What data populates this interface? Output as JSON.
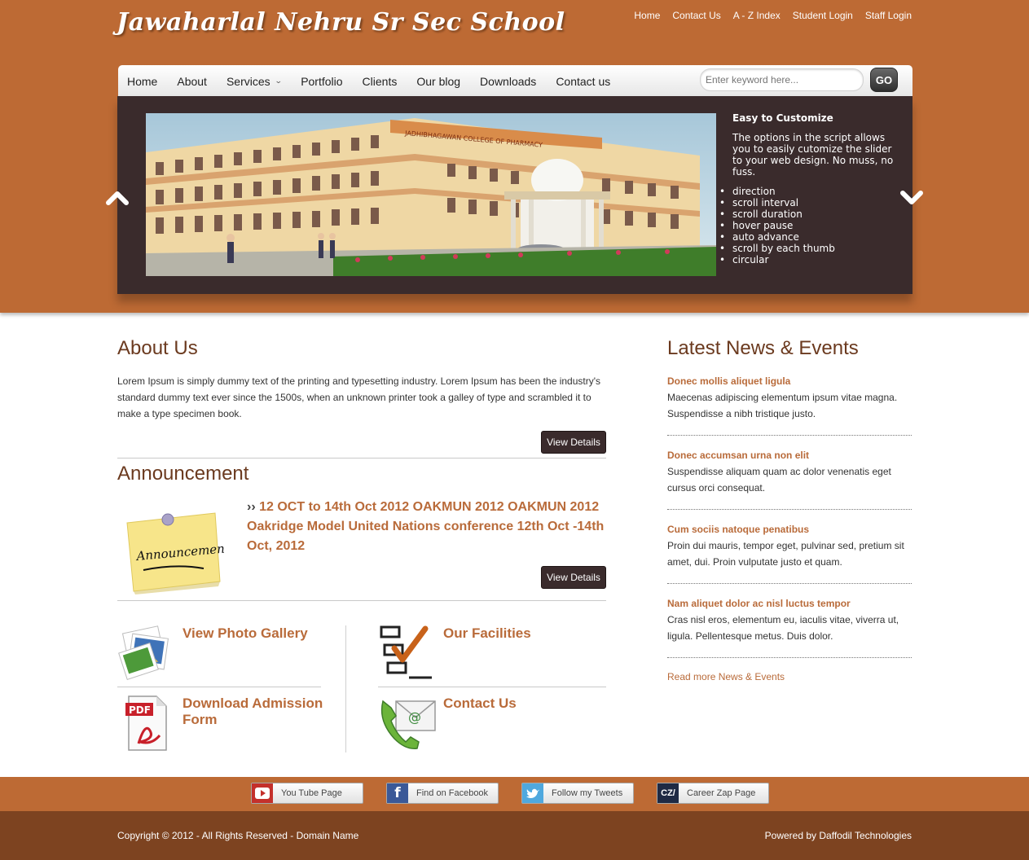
{
  "header": {
    "site_title": "Jawaharlal Nehru Sr Sec School",
    "top_links": [
      "Home",
      "Contact Us",
      "A - Z Index",
      "Student Login",
      "Staff Login"
    ]
  },
  "nav": {
    "items": [
      "Home",
      "About",
      "Services",
      "Portfolio",
      "Clients",
      "Our blog",
      "Downloads",
      "Contact us"
    ],
    "search_placeholder": "Enter keyword here...",
    "search_button": "GO"
  },
  "slider": {
    "image_banner_text": "JADHIBHAGAWAN COLLEGE OF PHARMACY",
    "caption_title": "Easy to Customize",
    "caption_text": "The options in the script allows you to easily cutomize the slider to your web design. No muss, no fuss.",
    "features": [
      "direction",
      "scroll interval",
      "scroll duration",
      "hover pause",
      "auto advance",
      "scroll by each thumb",
      "circular"
    ]
  },
  "about": {
    "title": "About Us",
    "text": "Lorem Ipsum is simply dummy text of the printing and typesetting industry. Lorem Ipsum has been the industry's standard dummy text ever since the 1500s, when an unknown printer took a galley of type and scrambled it to make a type specimen book.",
    "button": "View Details"
  },
  "announcement": {
    "title": "Announcement",
    "note_text": "Announcement!",
    "raquo": "››",
    "text": "12 OCT to 14th Oct 2012 OAKMUN 2012 OAKMUN 2012 Oakridge Model United Nations conference 12th Oct -14th Oct, 2012",
    "button": "View Details"
  },
  "tiles": {
    "gallery": "View Photo Gallery",
    "facilities": "Our Facilities",
    "admission": "Download Admission Form",
    "contact": "Contact Us",
    "pdf_label": "PDF"
  },
  "news": {
    "title": "Latest News & Events",
    "items": [
      {
        "head": "Donec mollis aliquet ligula",
        "body": "Maecenas adipiscing elementum ipsum vitae magna. Suspendisse a nibh tristique justo."
      },
      {
        "head": "Donec accumsan urna non elit",
        "body": "Suspendisse aliquam quam ac dolor venenatis eget cursus orci consequat."
      },
      {
        "head": "Cum sociis natoque penatibus",
        "body": "Proin dui mauris, tempor eget, pulvinar sed, pretium sit amet, dui. Proin vulputate justo et quam."
      },
      {
        "head": "Nam aliquet dolor ac nisl luctus tempor",
        "body": "Cras nisl eros, elementum eu, iaculis vitae, viverra ut, ligula. Pellentesque metus. Duis dolor."
      }
    ],
    "more": "Read more News & Events"
  },
  "social": {
    "youtube": "You Tube Page",
    "facebook": "Find on Facebook",
    "twitter": "Follow my Tweets",
    "careerzap": "Career Zap Page",
    "careerzap_icon": "CZ/"
  },
  "footer": {
    "copyright": "Copyright © 2012 - All Rights Reserved - Domain Name",
    "powered": "Powered by Daffodil Technologies"
  },
  "colors": {
    "header_bg": "#bd6a34",
    "footer_bg": "#7d4320",
    "accent_text": "#b96b3a",
    "heading": "#6b3a1f",
    "slider_bg": "#3a2b2c"
  }
}
